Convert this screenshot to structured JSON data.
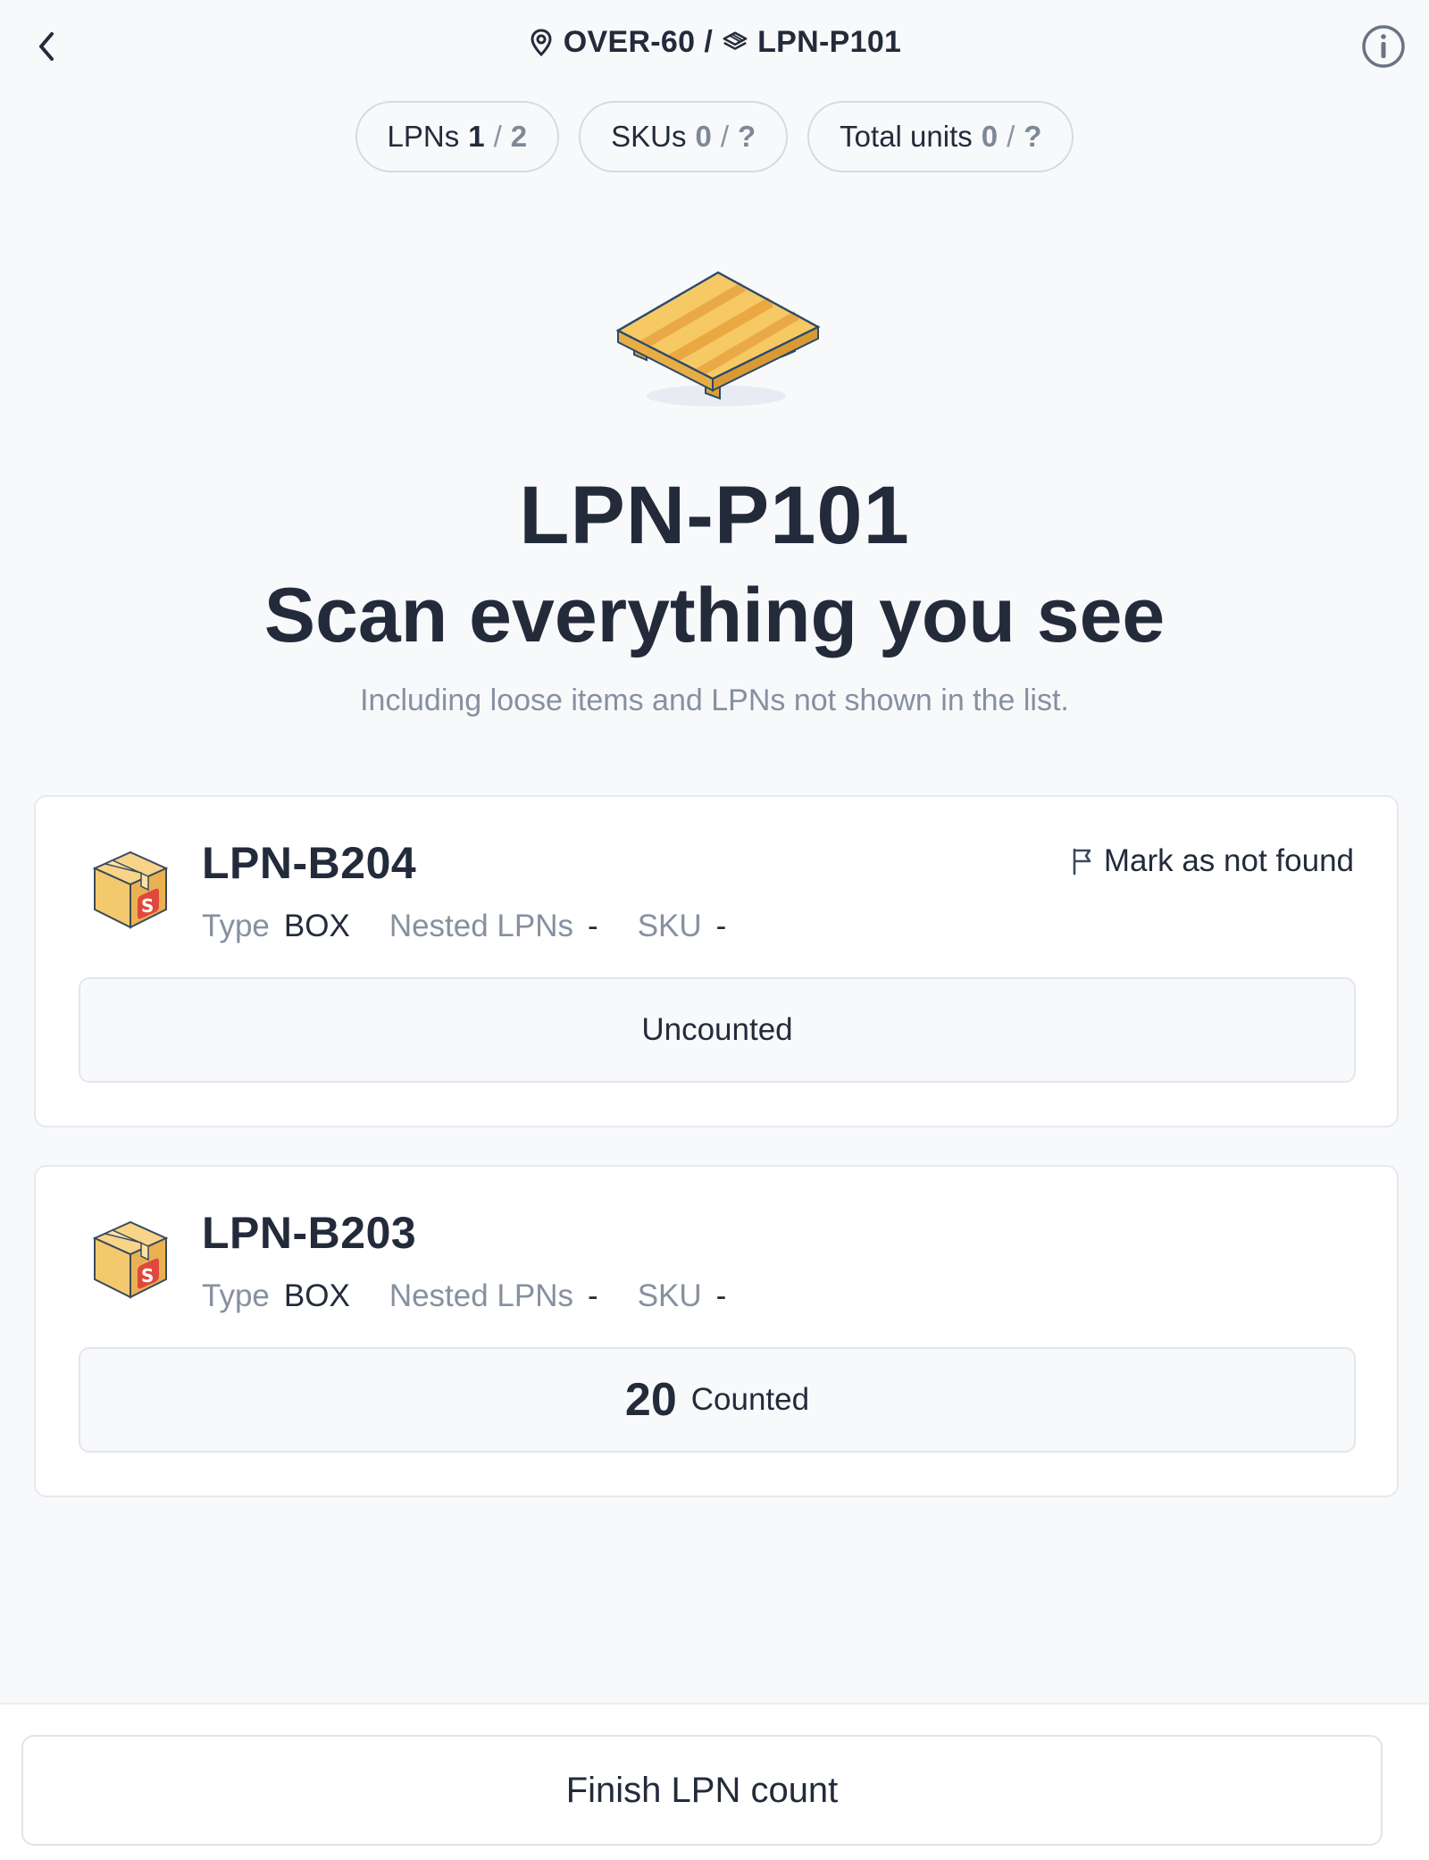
{
  "header": {
    "location": "OVER-60",
    "separator": "/",
    "lpn": "LPN-P101",
    "icons": {
      "back": "chevron-left-icon",
      "location": "map-pin-icon",
      "lpn": "pallet-stack-icon",
      "info": "info-circle-icon"
    }
  },
  "stats": {
    "lpns": {
      "label": "LPNs",
      "current": "1",
      "sep": "/",
      "total": "2"
    },
    "skus": {
      "label": "SKUs",
      "current": "0",
      "sep": "/",
      "total": "?"
    },
    "units": {
      "label": "Total units",
      "current": "0",
      "sep": "/",
      "total": "?"
    }
  },
  "hero": {
    "icon": "pallet-illustration",
    "lpn": "LPN-P101",
    "title": "Scan everything you see",
    "subtitle": "Including loose items and LPNs not shown in the list."
  },
  "cards": [
    {
      "name": "LPN-B204",
      "type_label": "Type",
      "type": "BOX",
      "nested_label": "Nested LPNs",
      "nested": "-",
      "sku_label": "SKU",
      "sku": "-",
      "mark_not_found": "Mark as not found",
      "status": "Uncounted"
    },
    {
      "name": "LPN-B203",
      "type_label": "Type",
      "type": "BOX",
      "nested_label": "Nested LPNs",
      "nested": "-",
      "sku_label": "SKU",
      "sku": "-",
      "count": "20",
      "status": "Counted"
    }
  ],
  "footer": {
    "finish_label": "Finish LPN count"
  },
  "colors": {
    "background": "#f8f9fb",
    "text": "#232b3b",
    "muted": "#8690a0",
    "border": "#e3e6eb",
    "pallet": "#f3c45e",
    "box_badge": "#e0483c"
  }
}
